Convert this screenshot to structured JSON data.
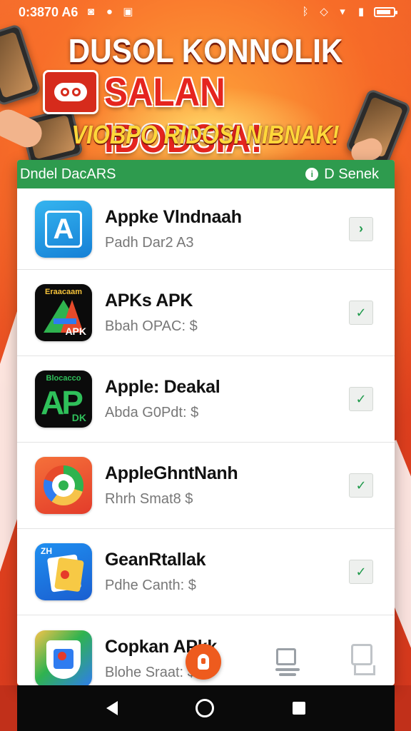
{
  "status_bar": {
    "time": "0:3870 A6",
    "left_icons": [
      "camera-icon",
      "record-icon",
      "image-icon"
    ],
    "right_icons": [
      "bluetooth-icon",
      "diamond-icon",
      "wifi-icon",
      "signal-icon",
      "battery-icon"
    ],
    "battery_level": 0.85
  },
  "banner": {
    "headline1": "DUSOL KONNOLIK",
    "headline2": "SALAN IDODSIA!",
    "headline3": "VIOBPO RIDOSI NIBNAK!",
    "colors": {
      "headline1": "#ffffff",
      "headline2": "#e5251f",
      "headline3": "#ffd83a"
    }
  },
  "card": {
    "header_left": "Dndel DacARS",
    "header_right": "D Senek",
    "header_icon": "info-icon",
    "header_color": "#2e9b4e"
  },
  "apps": [
    {
      "name": "Appke Vlndnaah",
      "sub": "Padh Dar2 A3",
      "icon": "blue-a-icon",
      "icon_text": "A",
      "action": "chevron-right-icon",
      "action_glyph": "›"
    },
    {
      "name": "APKs APK",
      "sub": "Bbah OPAC: $",
      "icon": "apk-triangle-icon",
      "icon_top": "Eraacaam",
      "icon_label": "APK",
      "action": "check-icon",
      "action_glyph": "✓"
    },
    {
      "name": "Apple: Deakal",
      "sub": "Abda G0Pdt: $",
      "icon": "ap-green-icon",
      "icon_top": "Blocacco",
      "icon_big": "AP",
      "icon_label": "DK",
      "action": "check-icon",
      "action_glyph": "✓"
    },
    {
      "name": "AppleGhntNanh",
      "sub": "Rhrh Smat8 $",
      "icon": "orange-ring-icon",
      "action": "check-icon",
      "action_glyph": "✓"
    },
    {
      "name": "GeanRtallak",
      "sub": "Pdhe Canth: $",
      "icon": "documents-icon",
      "icon_label": "ZH",
      "action": "check-icon",
      "action_glyph": "✓"
    },
    {
      "name": "Copkan APkk",
      "sub": "Blohe Sraat: $",
      "icon": "shield-colorful-icon"
    }
  ],
  "bottom_icons": [
    "lightbulb-icon",
    "laptop-icon",
    "stand-icon"
  ],
  "nav": [
    "back-icon",
    "home-icon",
    "recents-icon"
  ]
}
